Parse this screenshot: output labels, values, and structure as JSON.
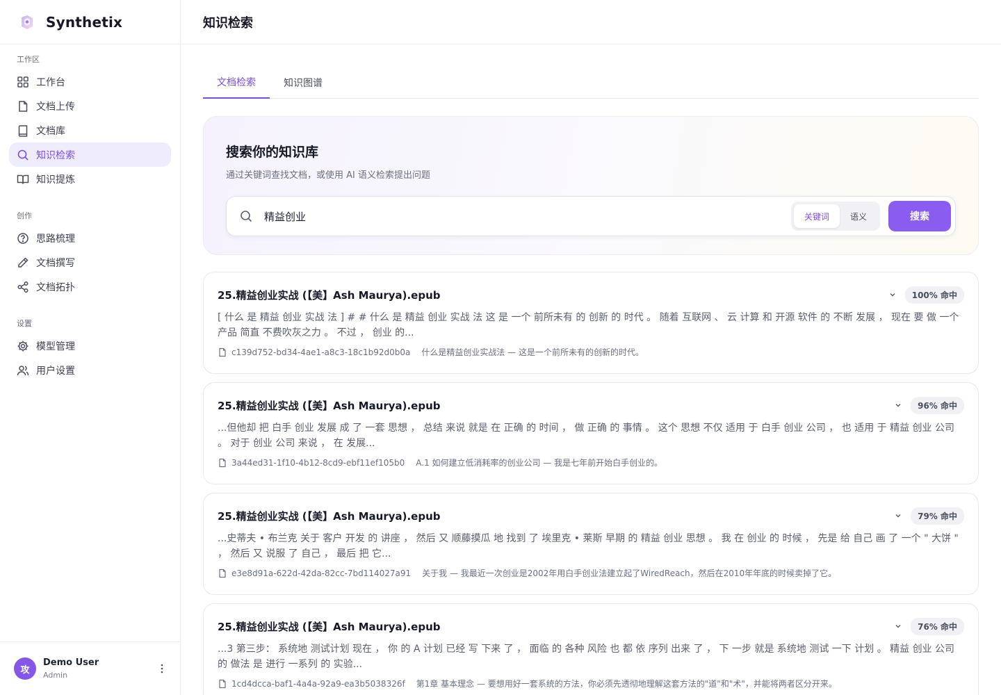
{
  "app": {
    "name": "Synthetix"
  },
  "colors": {
    "accent": "#7c4ddb",
    "button": "#8a5cf0",
    "avatar": "#8657e6"
  },
  "sidebar": {
    "sections": [
      {
        "title": "工作区",
        "items": [
          {
            "label": "工作台",
            "icon": "grid-icon"
          },
          {
            "label": "文档上传",
            "icon": "file-icon"
          },
          {
            "label": "文档库",
            "icon": "book-icon"
          },
          {
            "label": "知识检索",
            "icon": "search-icon",
            "active": true
          },
          {
            "label": "知识提炼",
            "icon": "open-book-icon"
          }
        ]
      },
      {
        "title": "创作",
        "items": [
          {
            "label": "思路梳理",
            "icon": "question-circle-icon"
          },
          {
            "label": "文档撰写",
            "icon": "pencil-icon"
          },
          {
            "label": "文档拓扑",
            "icon": "share-icon"
          }
        ]
      },
      {
        "title": "设置",
        "items": [
          {
            "label": "模型管理",
            "icon": "gear-icon"
          },
          {
            "label": "用户设置",
            "icon": "users-icon"
          }
        ]
      }
    ],
    "user": {
      "avatar": "攻",
      "name": "Demo User",
      "role": "Admin"
    }
  },
  "header": {
    "title": "知识检索"
  },
  "tabs": [
    {
      "label": "文档检索",
      "active": true
    },
    {
      "label": "知识图谱",
      "active": false
    }
  ],
  "search": {
    "title": "搜索你的知识库",
    "subtitle": "通过关键词查找文档，或使用 AI 语义检索提出问题",
    "value": "精益创业",
    "modes": [
      {
        "label": "关键词",
        "active": true
      },
      {
        "label": "语义",
        "active": false
      }
    ],
    "button": "搜索"
  },
  "results": [
    {
      "title": "25.精益创业实战 (【美】Ash Maurya).epub",
      "hit": "100% 命中",
      "snippet": "[ 什么 是 精益 创业 实战 法 ] # # 什么 是 精益 创业 实战 法 这 是 一个 前所未有 的 创新 的 时代 。 随着 互联网 、 云 计算 和 开源 软件 的 不断 发展 ， 现在 要 做 一个 产品 简直 不费吹灰之力 。 不过 ， 创业 的...",
      "doc_id": "c139d752-bd34-4ae1-a8c3-18c1b92d0b0a",
      "section": "什么是精益创业实战法 — 这是一个前所未有的创新的时代。"
    },
    {
      "title": "25.精益创业实战 (【美】Ash Maurya).epub",
      "hit": "96% 命中",
      "snippet": "...但他却 把 白手 创业 发展 成 了 一套 思想 ， 总结 来说 就是 在 正确 的 时间 ， 做 正确 的 事情 。 这个 思想 不仅 适用 于 白手 创业 公司 ， 也 适用 于 精益 创业 公司 。 对于 创业 公司 来说 ， 在 发展...",
      "doc_id": "3a44ed31-1f10-4b12-8cd9-ebf11ef105b0",
      "section": "A.1 如何建立低消耗率的创业公司 — 我是七年前开始白手创业的。"
    },
    {
      "title": "25.精益创业实战 (【美】Ash Maurya).epub",
      "hit": "79% 命中",
      "snippet": "...史蒂夫 • 布兰克 关于 客户 开发 的 讲座 ， 然后 又 顺藤摸瓜 地 找到 了 埃里克 • 莱斯 早期 的 精益 创业 思想 。 我 在 创业 的 时候 ， 先是 给 自己 画 了 一个 \" 大饼 \" ， 然后 又 说服 了 自己 ， 最后 把 它...",
      "doc_id": "e3e8d91a-622d-42da-82cc-7bd114027a91",
      "section": "关于我 — 我最近一次创业是2002年用白手创业法建立起了WiredReach，然后在2010年年底的时候卖掉了它。"
    },
    {
      "title": "25.精益创业实战 (【美】Ash Maurya).epub",
      "hit": "76% 命中",
      "snippet": "...3 第三步： 系统地 测试计划 现在 ， 你 的 A 计划 已经 写 下来 了 ， 面临 的 各种 风险 也 都 依 序列 出来 了 ， 下 一步 就是 系统地 测试 一下 计划 。 精益 创业 公司 的 做法 是 进行 一系列 的 实验...",
      "doc_id": "1cd4dcca-baf1-4a4a-92a9-ea3b5038326f",
      "section": "第1章 基本理念 — 要想用好一套系统的方法，你必须先透彻地理解这套方法的\"道\"和\"术\"，并能将两者区分开来。"
    }
  ]
}
